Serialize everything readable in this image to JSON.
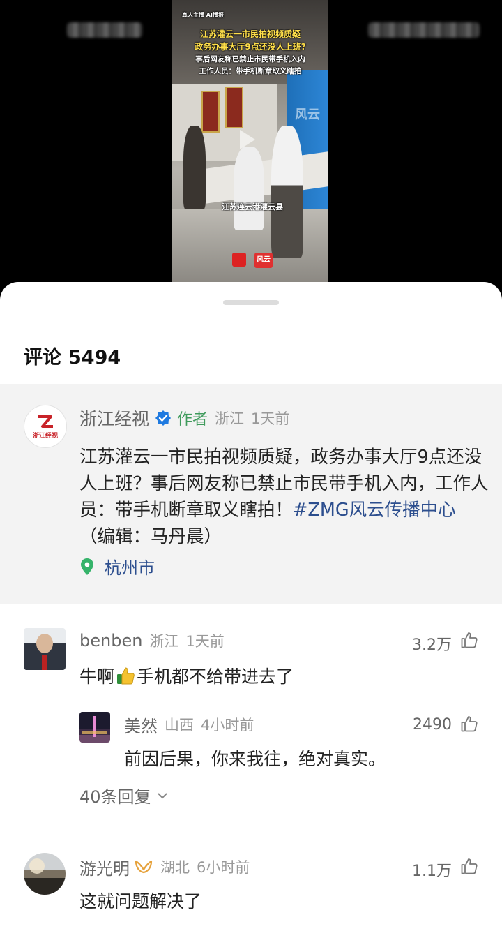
{
  "video": {
    "overlay_small": "真人主播 AI播报",
    "title_line1": "江苏灌云一市民拍视频质疑",
    "title_line2": "政务办事大厅9点还没人上班?",
    "title_line3": "事后网友称已禁止市民带手机入内",
    "title_line4": "工作人员：带手机断章取义瞎拍",
    "location_caption": "江苏连云港灌云县",
    "watermark": "风云",
    "logo_text": "风云"
  },
  "sheet": {
    "comments_label": "评论",
    "comments_count": "5494"
  },
  "author_post": {
    "name": "浙江经视",
    "avatar_label": "浙江经视",
    "badge": "作者",
    "location": "浙江",
    "time": "1天前",
    "text_main": "江苏灌云一市民拍视频质疑，政务办事大厅9点还没人上班？事后网友称已禁止市民带手机入内，工作人员：带手机断章取义瞎拍！",
    "hashtag": "#ZMG风云传播中心",
    "text_tail": "（编辑：马丹晨）",
    "geo": "杭州市"
  },
  "comments": [
    {
      "name": "benben",
      "location": "浙江",
      "time": "1天前",
      "likes": "3.2万",
      "text_before": "牛啊",
      "text_after": "手机都不给带进去了",
      "reply": {
        "name": "美然",
        "location": "山西",
        "time": "4小时前",
        "likes": "2490",
        "text": "前因后果，你来我往，绝对真实。"
      },
      "more_replies": "40条回复"
    },
    {
      "name": "游光明",
      "location": "湖北",
      "time": "6小时前",
      "likes": "1.1万",
      "text": "这就问题解决了"
    }
  ],
  "colors": {
    "hashtag_blue": "#2c4e8e",
    "author_badge_green": "#3f9b5c",
    "verified_blue": "#1f7ae0",
    "pin_green": "#35b36a"
  }
}
